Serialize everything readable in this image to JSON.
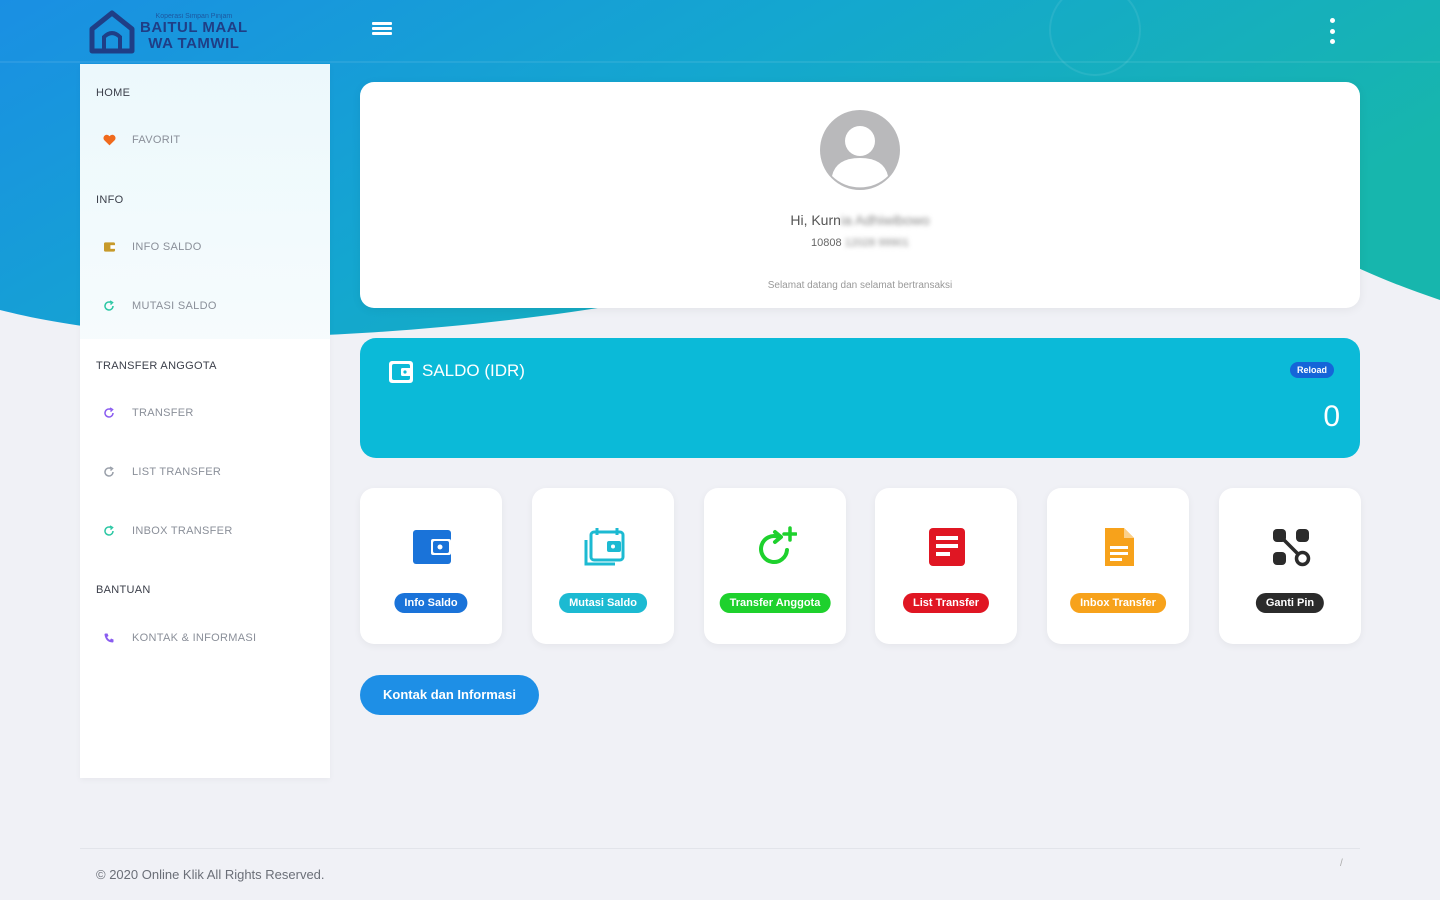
{
  "brand": {
    "tagline": "Koperasi Simpan Pinjam",
    "line1": "BAITUL MAAL",
    "line2": "WA TAMWIL",
    "primary_color": "#1f3e86"
  },
  "header": {
    "menu_icon": "hamburger-icon",
    "more_icon": "kebab-icon",
    "gradient_start": "#1e90e0",
    "gradient_end": "#17b3b0"
  },
  "sidebar": {
    "sections": [
      {
        "title": "HOME",
        "items": [
          {
            "label": "FAVORIT",
            "icon": "heart-icon",
            "color": "#f06a1c"
          }
        ]
      },
      {
        "title": "INFO",
        "items": [
          {
            "label": "INFO SALDO",
            "icon": "wallet-icon",
            "color": "#c79a2b"
          },
          {
            "label": "MUTASI SALDO",
            "icon": "refresh-icon",
            "color": "#2bc7a4"
          }
        ]
      },
      {
        "title": "TRANSFER ANGGOTA",
        "items": [
          {
            "label": "TRANSFER",
            "icon": "refresh-icon",
            "color": "#8a5cf0"
          },
          {
            "label": "LIST TRANSFER",
            "icon": "refresh-icon",
            "color": "#9aa0aa"
          },
          {
            "label": "INBOX TRANSFER",
            "icon": "refresh-icon",
            "color": "#2bc7a4"
          }
        ]
      },
      {
        "title": "BANTUAN",
        "items": [
          {
            "label": "KONTAK & INFORMASI",
            "icon": "phone-icon",
            "color": "#8a5cf0"
          }
        ]
      }
    ]
  },
  "profile": {
    "greeting_prefix": "Hi, Kurn",
    "greeting_blurred": "ia Adhiwibowo",
    "account_prefix": "10808",
    "account_blurred": "12028 99901",
    "welcome": "Selamat datang dan selamat bertransaksi"
  },
  "saldo": {
    "title": "SALDO (IDR)",
    "reload": "Reload",
    "amount": "0",
    "color": "#0bbad8"
  },
  "tiles": [
    {
      "label": "Info Saldo",
      "icon": "wallet-icon",
      "color": "#1a73d9"
    },
    {
      "label": "Mutasi Saldo",
      "icon": "calendar-wallet-icon",
      "color": "#1cbad2"
    },
    {
      "label": "Transfer Anggota",
      "icon": "refresh-plus-icon",
      "color": "#1ed12d"
    },
    {
      "label": "List Transfer",
      "icon": "document-list-icon",
      "color": "#e01623"
    },
    {
      "label": "Inbox Transfer",
      "icon": "document-icon",
      "color": "#f7a21b"
    },
    {
      "label": "Ganti Pin",
      "icon": "key-network-icon",
      "color": "#2b2b2b"
    }
  ],
  "contact_button": "Kontak dan Informasi",
  "footer": {
    "copyright": "© 2020 Online Klik All Rights Reserved.",
    "mark": "/"
  }
}
